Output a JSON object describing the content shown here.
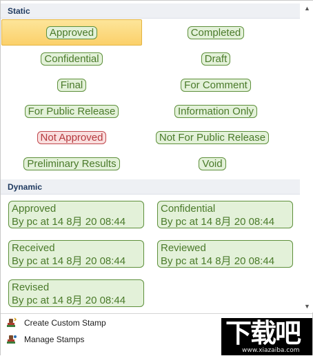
{
  "sections": {
    "static_title": "Static",
    "dynamic_title": "Dynamic"
  },
  "static_stamps": [
    {
      "label": "Approved",
      "color": "green",
      "selected": true
    },
    {
      "label": "Completed",
      "color": "green"
    },
    {
      "label": "Confidential",
      "color": "green"
    },
    {
      "label": "Draft",
      "color": "green"
    },
    {
      "label": "Final",
      "color": "green"
    },
    {
      "label": "For Comment",
      "color": "green"
    },
    {
      "label": "For Public Release",
      "color": "green"
    },
    {
      "label": "Information Only",
      "color": "green"
    },
    {
      "label": "Not Approved",
      "color": "red"
    },
    {
      "label": "Not For Public Release",
      "color": "green"
    },
    {
      "label": "Preliminary Results",
      "color": "green"
    },
    {
      "label": "Void",
      "color": "green"
    }
  ],
  "dynamic_stamps": [
    {
      "line1": "Approved",
      "line2": "By pc at 14 8月 20 08:44"
    },
    {
      "line1": "Confidential",
      "line2": "By pc at 14 8月 20 08:44"
    },
    {
      "line1": "Received",
      "line2": "By pc at 14 8月 20 08:44"
    },
    {
      "line1": "Reviewed",
      "line2": "By pc at 14 8月 20 08:44"
    },
    {
      "line1": "Revised",
      "line2": "By pc at 14 8月 20 08:44"
    }
  ],
  "menu": {
    "create_custom_stamp": "Create Custom Stamp",
    "manage_stamps": "Manage Stamps"
  },
  "scrollbar": {
    "up_icon": "triangle-up-icon",
    "down_icon": "triangle-down-icon"
  },
  "watermark": {
    "logo_text": "下载吧",
    "url_text": "www.xiazaiba.com"
  },
  "colors": {
    "stamp_green_border": "#5d8f3a",
    "stamp_green_fill": "#e3f1d9",
    "stamp_red_border": "#c0484d",
    "stamp_red_fill": "#f9dede",
    "selection": "#fbd06a"
  }
}
